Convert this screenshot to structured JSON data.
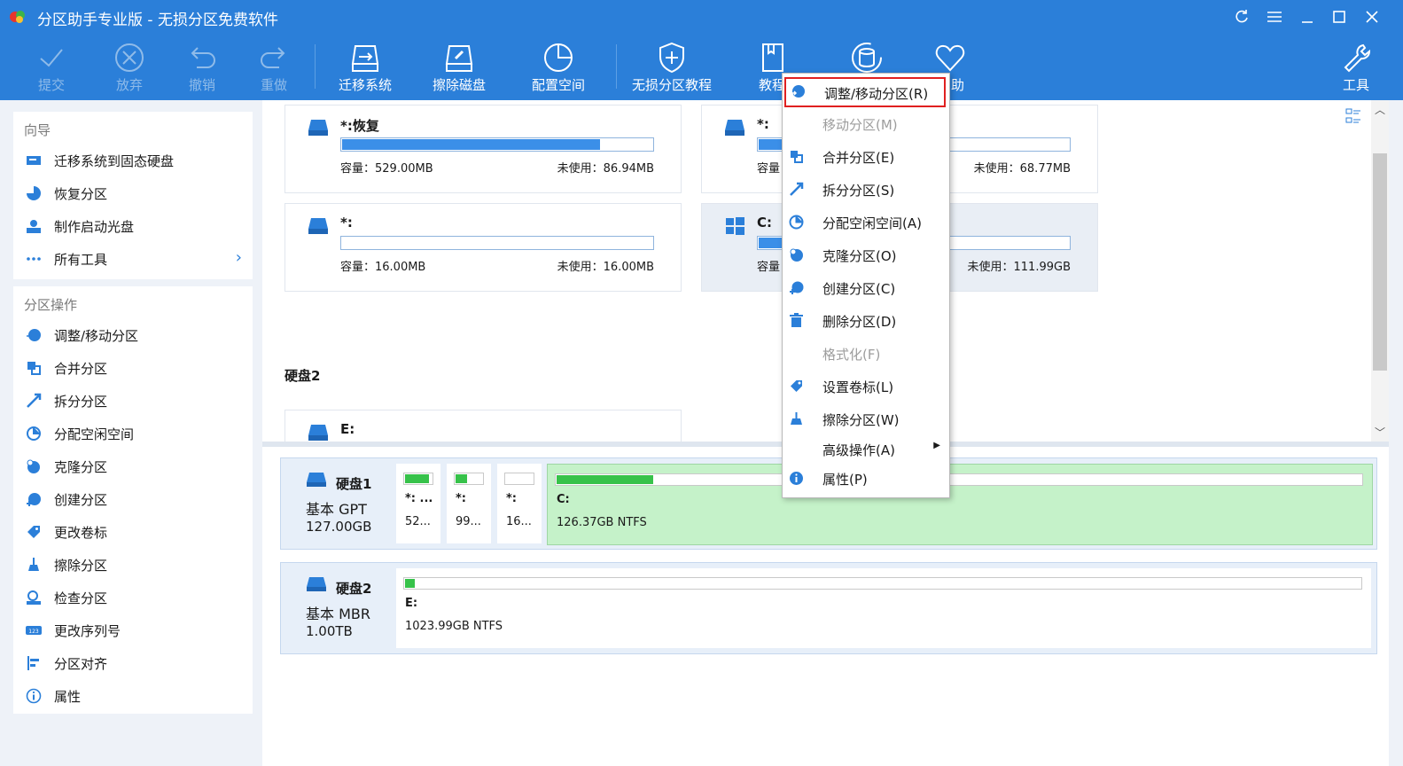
{
  "window": {
    "title": "分区助手专业版 - 无损分区免费软件"
  },
  "toolbar": {
    "commit": "提交",
    "discard": "放弃",
    "undo": "撤销",
    "redo": "重做",
    "migrate": "迁移系统",
    "wipe_disk": "擦除磁盘",
    "allocate": "配置空间",
    "tutorial": "无损分区教程",
    "tutorial2": "教程",
    "help_fragment": "助",
    "tools": "工具"
  },
  "wizard": {
    "heading": "向导",
    "items": [
      {
        "label": "迁移系统到固态硬盘"
      },
      {
        "label": "恢复分区"
      },
      {
        "label": "制作启动光盘"
      },
      {
        "label": "所有工具"
      }
    ]
  },
  "partition_ops": {
    "heading": "分区操作",
    "items": [
      {
        "label": "调整/移动分区"
      },
      {
        "label": "合并分区"
      },
      {
        "label": "拆分分区"
      },
      {
        "label": "分配空闲空间"
      },
      {
        "label": "克隆分区"
      },
      {
        "label": "创建分区"
      },
      {
        "label": "更改卷标"
      },
      {
        "label": "擦除分区"
      },
      {
        "label": "检查分区"
      },
      {
        "label": "更改序列号"
      },
      {
        "label": "分区对齐"
      },
      {
        "label": "属性"
      }
    ]
  },
  "partition_cards": [
    {
      "name": "*:恢复",
      "capacity": "容量：529.00MB",
      "free": "未使用：86.94MB",
      "used_fraction": 0.83
    },
    {
      "name": "*:",
      "capacity": "容量",
      "free": "未使用：68.77MB",
      "used_fraction": 0.1
    },
    {
      "name": "*:",
      "capacity": "容量：16.00MB",
      "free": "未使用：16.00MB",
      "used_fraction": 0.0
    },
    {
      "name": "C:",
      "capacity": "容量",
      "free": "未使用：111.99GB",
      "used_fraction": 0.12
    }
  ],
  "disk2_label": "硬盘2",
  "disk2_partial": {
    "name": "E:"
  },
  "disks": [
    {
      "name": "硬盘1",
      "type": "基本 GPT",
      "size": "127.00GB",
      "partitions": [
        {
          "label": "*: ...",
          "detail": "52...",
          "used_fraction": 0.85
        },
        {
          "label": "*:",
          "detail": "99...",
          "used_fraction": 0.4
        },
        {
          "label": "*:",
          "detail": "16...",
          "used_fraction": 0.0
        },
        {
          "label": "C:",
          "detail": "126.37GB NTFS",
          "used_fraction": 0.12
        }
      ]
    },
    {
      "name": "硬盘2",
      "type": "基本 MBR",
      "size": "1.00TB",
      "partitions": [
        {
          "label": "E:",
          "detail": "1023.99GB NTFS",
          "used_fraction": 0.01
        }
      ]
    }
  ],
  "context_menu": {
    "items": [
      {
        "label": "调整/移动分区(R)",
        "enabled": true,
        "highlighted": true
      },
      {
        "label": "移动分区(M)",
        "enabled": false
      },
      {
        "label": "合并分区(E)",
        "enabled": true
      },
      {
        "label": "拆分分区(S)",
        "enabled": true
      },
      {
        "label": "分配空闲空间(A)",
        "enabled": true
      },
      {
        "label": "克隆分区(O)",
        "enabled": true
      },
      {
        "label": "创建分区(C)",
        "enabled": true
      },
      {
        "label": "删除分区(D)",
        "enabled": true
      },
      {
        "label": "格式化(F)",
        "enabled": false
      },
      {
        "label": "设置卷标(L)",
        "enabled": true
      },
      {
        "label": "擦除分区(W)",
        "enabled": true
      },
      {
        "label": "高级操作(A)",
        "enabled": true,
        "submenu": true
      },
      {
        "label": "属性(P)",
        "enabled": true
      }
    ]
  },
  "colors": {
    "accent": "#2b7fd9",
    "highlight_border": "#e02020",
    "partition_green": "#37c24a",
    "bar_blue": "#3b8fe8"
  }
}
